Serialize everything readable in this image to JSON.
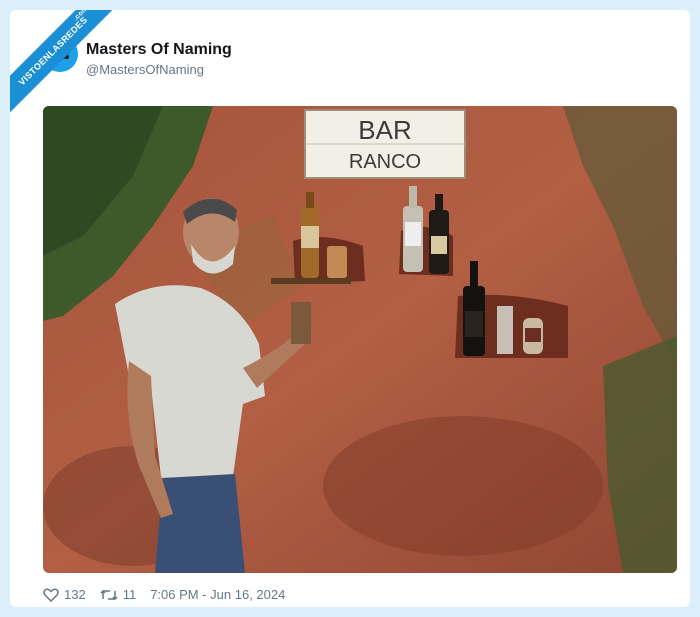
{
  "ribbon": {
    "text": "VISTOENLASREDES",
    "sub": ".com"
  },
  "author": {
    "name": "Masters Of Naming",
    "handle": "@MastersOfNaming"
  },
  "photo": {
    "sign_line1": "BAR",
    "sign_line2": "RANCO"
  },
  "stats": {
    "likes": "132",
    "retweets": "11",
    "timestamp": "7:06 PM - Jun 16, 2024"
  },
  "colors": {
    "accent": "#1da0e8",
    "ribbon": "#1a8fd6",
    "background": "#dbeefa"
  }
}
